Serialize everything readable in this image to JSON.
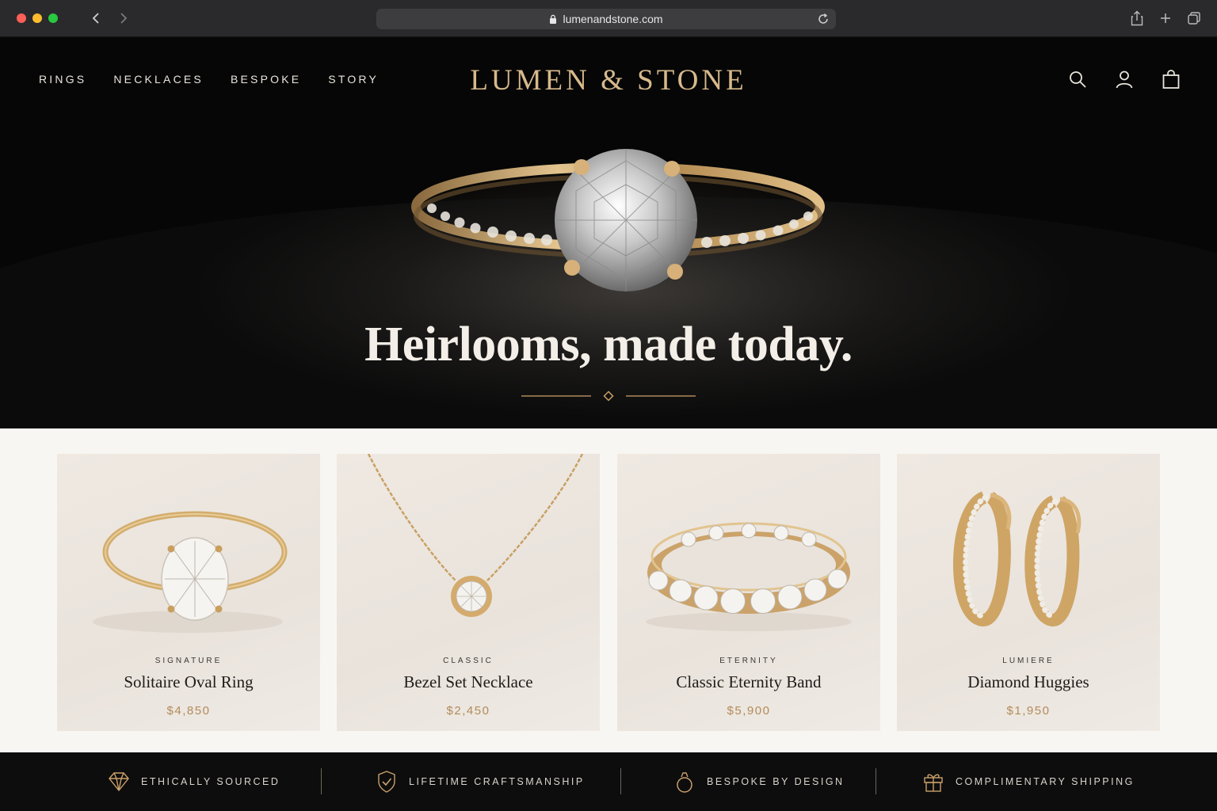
{
  "browser": {
    "url": "lumenandstone.com",
    "icons": [
      "back-icon",
      "forward-icon",
      "lock-icon",
      "reload-icon",
      "share-icon",
      "new-tab-icon",
      "tabs-icon"
    ]
  },
  "header": {
    "nav": [
      "RINGS",
      "NECKLACES",
      "BESPOKE",
      "STORY"
    ],
    "logo": "LUMEN & STONE",
    "icons": [
      "search-icon",
      "account-icon",
      "bag-icon"
    ]
  },
  "hero": {
    "headline": "Heirlooms, made today."
  },
  "products": [
    {
      "category": "SIGNATURE",
      "name": "Solitaire Oval Ring",
      "price": "$4,850"
    },
    {
      "category": "CLASSIC",
      "name": "Bezel Set Necklace",
      "price": "$2,450"
    },
    {
      "category": "ETERNITY",
      "name": "Classic Eternity Band",
      "price": "$5,900"
    },
    {
      "category": "LUMIERE",
      "name": "Diamond Huggies",
      "price": "$1,950"
    }
  ],
  "benefits": [
    {
      "icon": "diamond-icon",
      "label": "ETHICALLY SOURCED"
    },
    {
      "icon": "shield-check-icon",
      "label": "LIFETIME CRAFTSMANSHIP"
    },
    {
      "icon": "ring-icon",
      "label": "BESPOKE BY DESIGN"
    },
    {
      "icon": "gift-icon",
      "label": "COMPLIMENTARY SHIPPING"
    }
  ],
  "colors": {
    "gold": "#d7b98c",
    "price_gold": "#b38b5a",
    "hero_bg": "#060606",
    "product_bg": "#f8f6f2"
  }
}
